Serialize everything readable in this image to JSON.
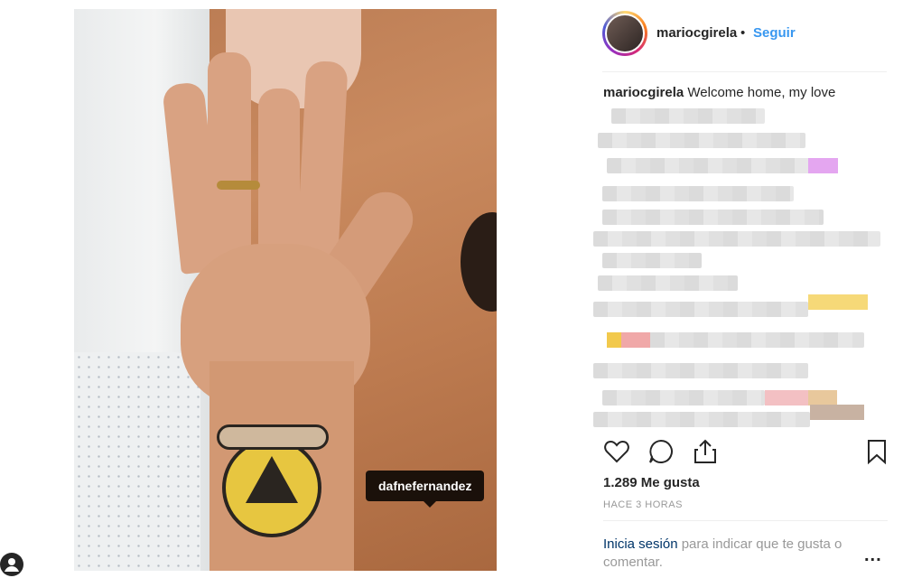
{
  "post": {
    "photo_tag": "dafnefernandez"
  },
  "header": {
    "username": "mariocgirela",
    "dot": "•",
    "follow_label": "Seguir"
  },
  "caption": {
    "username": "mariocgirela",
    "text": "Welcome home, my love"
  },
  "stats": {
    "likes": "1.289 Me gusta",
    "time": "HACE 3 HORAS"
  },
  "login_prompt": {
    "link": "Inicia sesión",
    "text": " para indicar que te gusta o comentar."
  },
  "more_label": "...",
  "icons": [
    "heart-icon",
    "comment-icon",
    "share-icon",
    "bookmark-icon",
    "more-icon",
    "user-icon"
  ],
  "colors": {
    "accent": "#3897f0",
    "link": "#003569",
    "muted": "#999999",
    "text": "#262626"
  }
}
